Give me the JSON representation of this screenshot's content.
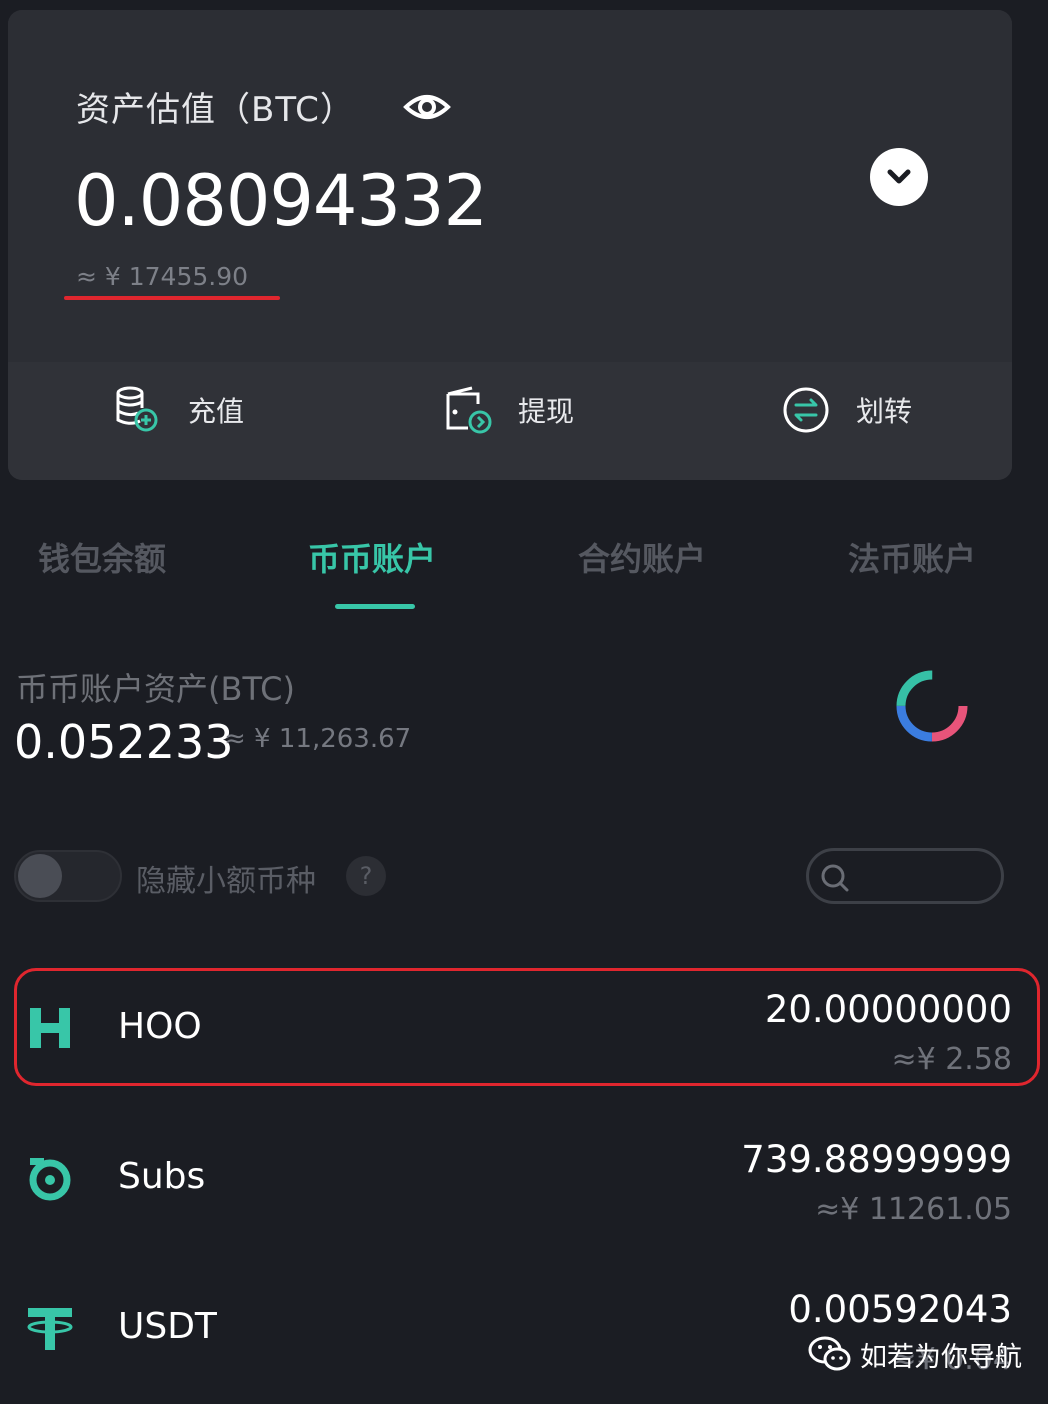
{
  "summary": {
    "title": "资产估值（BTC）",
    "amount": "0.08094332",
    "fiat": "≈ ¥ 17455.90"
  },
  "actions": [
    {
      "label": "充值",
      "icon": "deposit-icon"
    },
    {
      "label": "提现",
      "icon": "withdraw-icon"
    },
    {
      "label": "划转",
      "icon": "transfer-icon"
    }
  ],
  "tabs": [
    "钱包余额",
    "币币账户",
    "合约账户",
    "法币账户"
  ],
  "active_tab": "币币账户",
  "account": {
    "label": "币币账户资产(BTC)",
    "amount": "0.052233",
    "fiat": "≈ ¥ 11,263.67"
  },
  "filter": {
    "hide_small_label": "隐藏小额币种",
    "help": "?",
    "hide_small_enabled": false
  },
  "assets": [
    {
      "name": "HOO",
      "qty": "20.00000000",
      "value": "≈¥ 2.58",
      "icon": "hoo-logo-icon"
    },
    {
      "name": "Subs",
      "qty": "739.88999999",
      "value": "≈¥ 11261.05",
      "icon": "subs-logo-icon"
    },
    {
      "name": "USDT",
      "qty": "0.00592043",
      "value": "≈¥ 0.04",
      "icon": "tether-logo-icon"
    }
  ],
  "watermark": "如若为你导航",
  "colors": {
    "accent": "#38c6a8",
    "highlight": "#e0262e",
    "background": "#1b1d23"
  }
}
